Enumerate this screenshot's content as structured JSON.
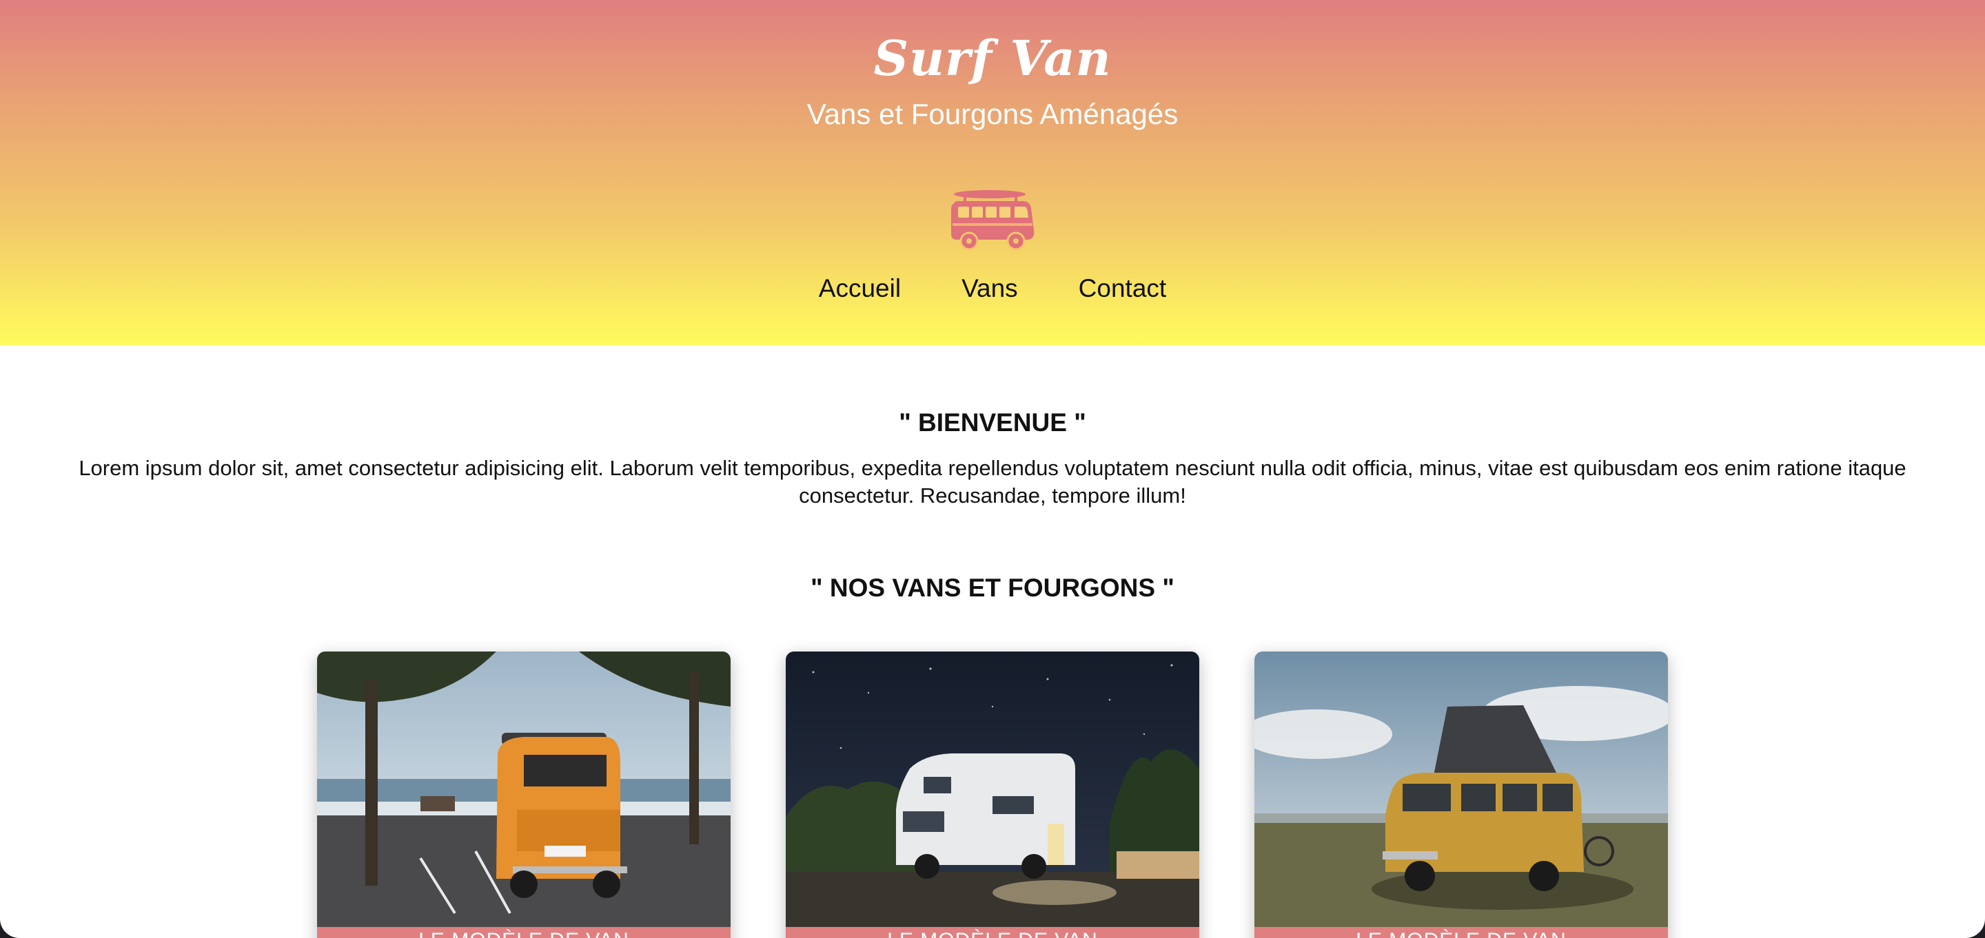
{
  "header": {
    "brand": "Surf Van",
    "tagline": "Vans et Fourgons Aménagés",
    "logo_icon": "van-with-surfboard-icon",
    "nav": [
      {
        "label": "Accueil"
      },
      {
        "label": "Vans"
      },
      {
        "label": "Contact"
      }
    ]
  },
  "welcome": {
    "title": "\" BIENVENUE \"",
    "text": "Lorem ipsum dolor sit, amet consectetur adipisicing elit. Laborum velit temporibus, expedita repellendus voluptatem nesciunt nulla odit officia, minus, vitae est quibusdam eos enim ratione itaque consectetur. Recusandae, tempore illum!"
  },
  "vans_section": {
    "title": "\" NOS VANS ET FOURGONS \"",
    "cards": [
      {
        "caption": "LE MODÈLE DE VAN"
      },
      {
        "caption": "LE MODÈLE DE VAN"
      },
      {
        "caption": "LE MODÈLE DE VAN"
      }
    ]
  },
  "colors": {
    "gradient_top": "#e07f80",
    "gradient_bottom": "#fffb5c",
    "accent": "#e07f80"
  }
}
